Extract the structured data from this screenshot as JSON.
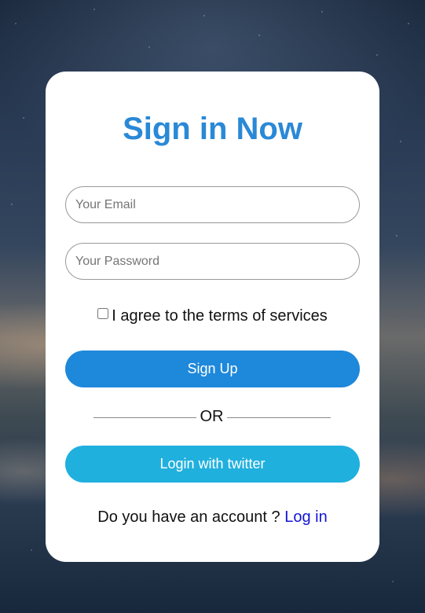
{
  "form": {
    "title": "Sign in Now",
    "email_placeholder": "Your Email",
    "email_value": "",
    "password_placeholder": "Your Password",
    "password_value": "",
    "terms_checked": false,
    "terms_label": "I agree to the terms of services",
    "signup_label": "Sign Up",
    "divider_label": "OR",
    "twitter_label": "Login with twitter",
    "account_prompt": "Do you have an account ?",
    "login_link": "Log in"
  },
  "colors": {
    "title": "#2a89d6",
    "signup_button": "#1e88db",
    "twitter_button": "#20b0de",
    "link": "#1414d6"
  }
}
